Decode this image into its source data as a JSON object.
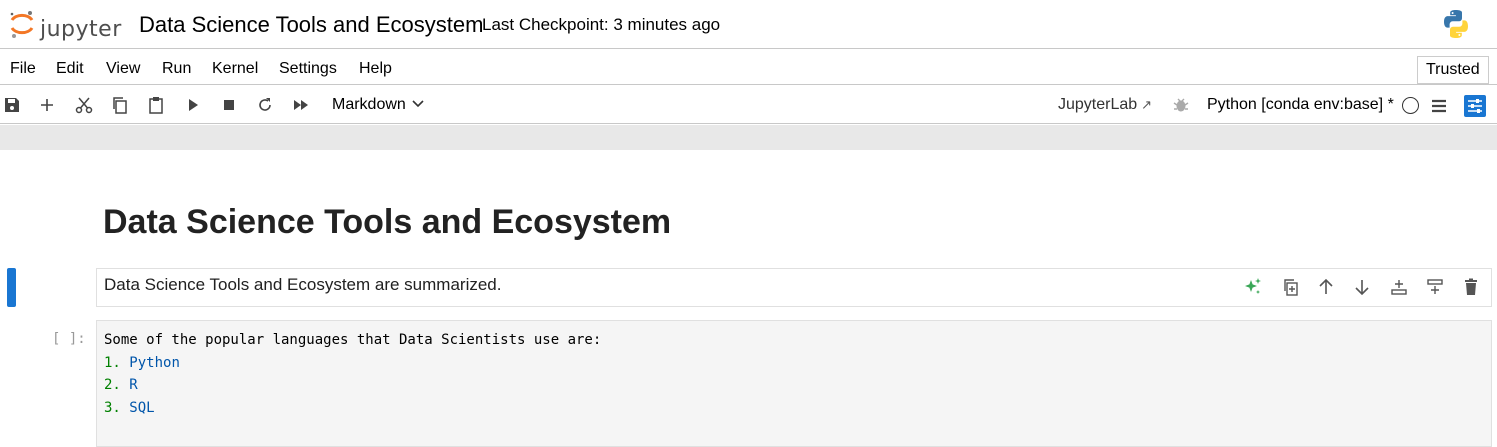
{
  "header": {
    "logo_text": "jupyter",
    "notebook_title": "Data Science Tools and Ecosystem",
    "checkpoint": "Last Checkpoint: 3 minutes ago"
  },
  "menu": {
    "items": [
      "File",
      "Edit",
      "View",
      "Run",
      "Kernel",
      "Settings",
      "Help"
    ],
    "trusted": "Trusted"
  },
  "toolbar": {
    "icons": [
      "save-icon",
      "add-icon",
      "cut-icon",
      "copy-icon",
      "paste-icon",
      "run-icon",
      "stop-icon",
      "restart-icon",
      "fast-forward-icon"
    ],
    "cell_type": "Markdown",
    "jupyterlab_link": "JupyterLab",
    "kernel_name": "Python [conda env:base] *"
  },
  "notebook": {
    "heading": "Data Science Tools and Ecosystem",
    "markdown_cell_text": "Data Science Tools and Ecosystem are summarized.",
    "code_prompt": "[ ]:",
    "code_intro": "Some of the popular languages that Data Scientists use are:",
    "code_items": [
      {
        "num": "1.",
        "name": "Python"
      },
      {
        "num": "2.",
        "name": "R"
      },
      {
        "num": "3.",
        "name": "SQL"
      }
    ],
    "cell_tools": [
      "sparkle-icon",
      "duplicate-icon",
      "move-up-icon",
      "move-down-icon",
      "insert-below-icon",
      "insert-above-icon",
      "delete-icon"
    ]
  },
  "colors": {
    "accent": "#1976d2",
    "number": "#008000",
    "list_text": "#0055aa",
    "logo_orange": "#f37726"
  }
}
